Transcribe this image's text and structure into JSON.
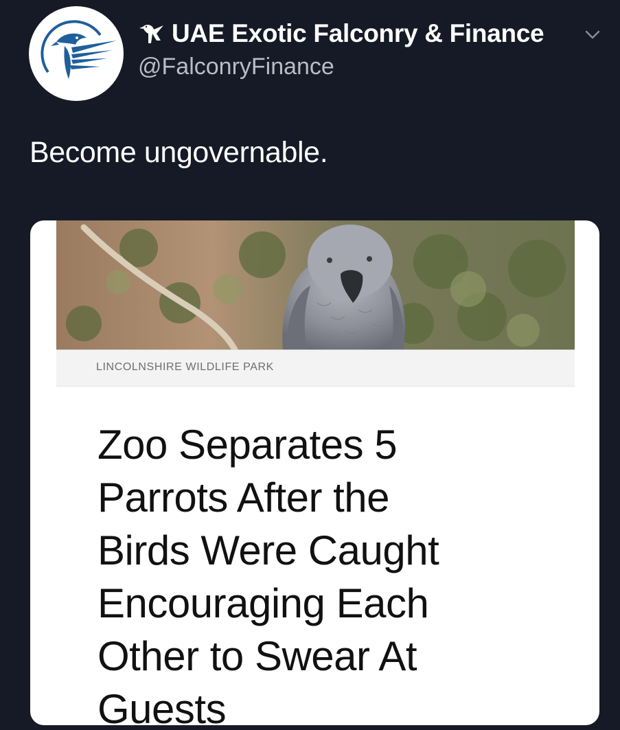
{
  "tweet": {
    "author": {
      "display_name": "UAE Exotic Falconry & Finance",
      "handle": "@FalconryFinance",
      "avatar_icon": "falcon-logo-icon",
      "name_prefix_icon": "falcon-glyph-icon"
    },
    "menu_icon": "chevron-down-icon",
    "text": "Become ungovernable."
  },
  "card": {
    "image_description_icon": "parrot-photo",
    "source": "LINCOLNSHIRE WILDLIFE PARK",
    "headline_lines": [
      "Zoo Separates 5",
      "Parrots After the",
      "Birds Were Caught",
      "Encouraging Each",
      "Other to Swear At",
      "Guests"
    ]
  },
  "colors": {
    "background": "#161a26",
    "avatar_blue": "#1f5f9c",
    "card_background": "#ffffff",
    "headline_text": "#111111"
  }
}
